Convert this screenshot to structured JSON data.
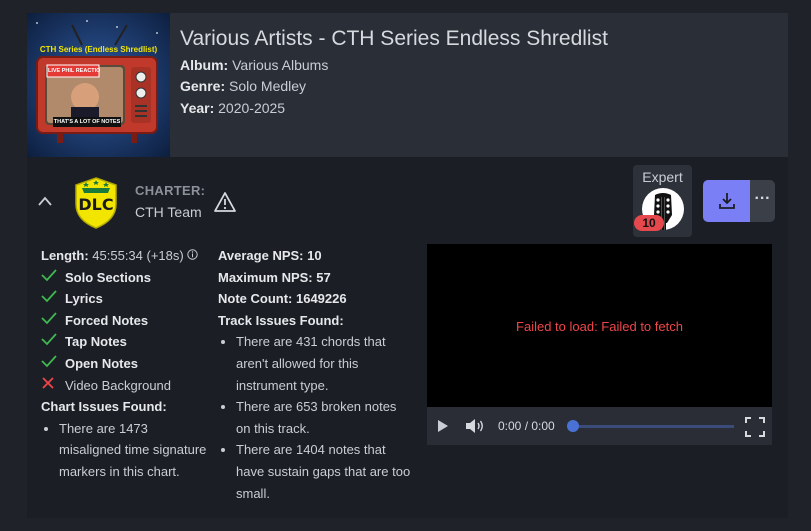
{
  "album": {
    "title": "Various Artists - CTH Series Endless Shredlist",
    "album_label": "Album:",
    "album_value": "Various Albums",
    "genre_label": "Genre:",
    "genre_value": "Solo Medley",
    "year_label": "Year:",
    "year_value": "2020-2025",
    "cover": {
      "top_text": "CTH Series (Endless Shredlist)",
      "sign_text": "LIVE PHIL REACTION",
      "bottom_text": "THAT'S A LOT OF NOTES",
      "colors": {
        "bg": "#1d3a6b",
        "tv": "#c0392b",
        "yellow": "#f2e600"
      }
    }
  },
  "charter": {
    "label": "CHARTER:",
    "name": "CTH Team",
    "logo_text": "DLC",
    "warning_icon": "warning-triangle-icon"
  },
  "difficulty": {
    "label": "Expert",
    "level": "10",
    "icon": "guitar-headstock-icon"
  },
  "actions": {
    "download_icon": "download-icon",
    "more_label": "···"
  },
  "stats": {
    "length_label": "Length:",
    "length_value": "45:55:34 (+18s)",
    "features": [
      {
        "label": "Solo Sections",
        "present": true
      },
      {
        "label": "Lyrics",
        "present": true
      },
      {
        "label": "Forced Notes",
        "present": true
      },
      {
        "label": "Tap Notes",
        "present": true
      },
      {
        "label": "Open Notes",
        "present": true
      },
      {
        "label": "Video Background",
        "present": false
      }
    ],
    "chart_issues_heading": "Chart Issues Found:",
    "chart_issues": [
      "There are 1473 misaligned time signature markers in this chart."
    ],
    "avg_nps_label": "Average NPS: 10",
    "max_nps_label": "Maximum NPS: 57",
    "note_count_label": "Note Count: 1649226",
    "track_issues_heading": "Track Issues Found:",
    "track_issues": [
      "There are 431 chords that aren't allowed for this instrument type.",
      "There are 653 broken notes on this track.",
      "There are 1404 notes that have sustain gaps that are too small."
    ]
  },
  "video": {
    "error_text": "Failed to load: Failed to fetch",
    "time_text": "0:00 / 0:00",
    "progress": 0
  },
  "colors": {
    "accent": "#7b7ff5",
    "check": "#3fb950",
    "cross": "#f0464a",
    "error": "#f0464a",
    "badge": "#e5484d"
  }
}
